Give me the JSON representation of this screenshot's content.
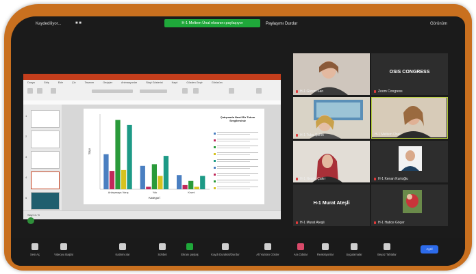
{
  "window": {
    "share_info": "Kaydediliyor...",
    "banner": "H-1 Meltem Ünal ekranını paylaşıyor",
    "stop_share": "Paylaşımı Durdur",
    "view": "Görünüm"
  },
  "ppt": {
    "title": "Kaydet  Dosya  Giriş  Ekle  Tasarım  Geçişler  Animasyonlar  Slayt Gösterisi  Gözden Geçir  Görünüm  Yardım",
    "tabs": [
      "Dosya",
      "Giriş",
      "Ekle",
      "Çiz",
      "Tasarım",
      "Geçişler",
      "Animasyonlar",
      "Slayt Gösterisi",
      "Kayıt",
      "Gözden Geçir",
      "Görünüm",
      "Yardım"
    ],
    "slide_numbers": [
      "1",
      "2",
      "3",
      "4",
      "5"
    ],
    "status": "Slayt 4 / 5"
  },
  "chart_data": {
    "type": "bar",
    "title": "",
    "xlabel": "Kategori",
    "ylabel": "Sayı",
    "categories": [
      "Anlaşmaya Varış",
      "Yok",
      "Kısmi"
    ],
    "series": [
      {
        "color": "#4a7fc1",
        "values": [
          42,
          28,
          17
        ]
      },
      {
        "color": "#c0285a",
        "values": [
          22,
          3,
          5
        ]
      },
      {
        "color": "#2a9a3a",
        "values": [
          83,
          30,
          10
        ]
      },
      {
        "color": "#d6c21f",
        "values": [
          23,
          16,
          3
        ]
      },
      {
        "color": "#1d9a86",
        "values": [
          77,
          40,
          16
        ]
      }
    ],
    "ylim": [
      0,
      90
    ],
    "grid": false,
    "legend": "right"
  },
  "legend": {
    "title": "Çatışmada Nasıl Bir Tutum Sergilersiniz",
    "items": [
      "",
      "",
      "",
      "",
      "",
      "",
      "",
      "",
      ""
    ],
    "colors": [
      "#4a7fc1",
      "#c0285a",
      "#2a9a3a",
      "#d6c21f",
      "#1d9a86",
      "#4a7fc1",
      "#c0285a",
      "#2a9a3a",
      "#d6c21f"
    ]
  },
  "participants": [
    {
      "name": "H-1 Gizem Sarı",
      "kind": "video"
    },
    {
      "name": "Zoom Congress",
      "kind": "text",
      "label": "OSIS CONGRESS"
    },
    {
      "name": "H-1 Tuba Şahin",
      "kind": "video"
    },
    {
      "name": "H-1 Meltem Ünal",
      "kind": "video"
    },
    {
      "name": "H-1 Nesrin Çakır",
      "kind": "video"
    },
    {
      "name": "H-1 Kenan Kurtoğlu",
      "kind": "video"
    },
    {
      "name": "H-1 Murat Ateşli",
      "kind": "text",
      "label": "H-1 Murat Ateşli"
    },
    {
      "name": "H-1 Hatice Göçer",
      "kind": "video"
    }
  ],
  "toolbar": {
    "items": [
      "Sesi Aç",
      "Videoyu Başlat",
      "Katılımcılar",
      "Sohbet",
      "Ekranı paylaş",
      "Kaydı Duraklat/Durdur",
      "Alt Yazıları Göster",
      "Ara Odalar",
      "Reaksiyonlar",
      "Uygulamalar",
      "Beyaz Tahtalar"
    ],
    "leave": "Ayrıl"
  }
}
